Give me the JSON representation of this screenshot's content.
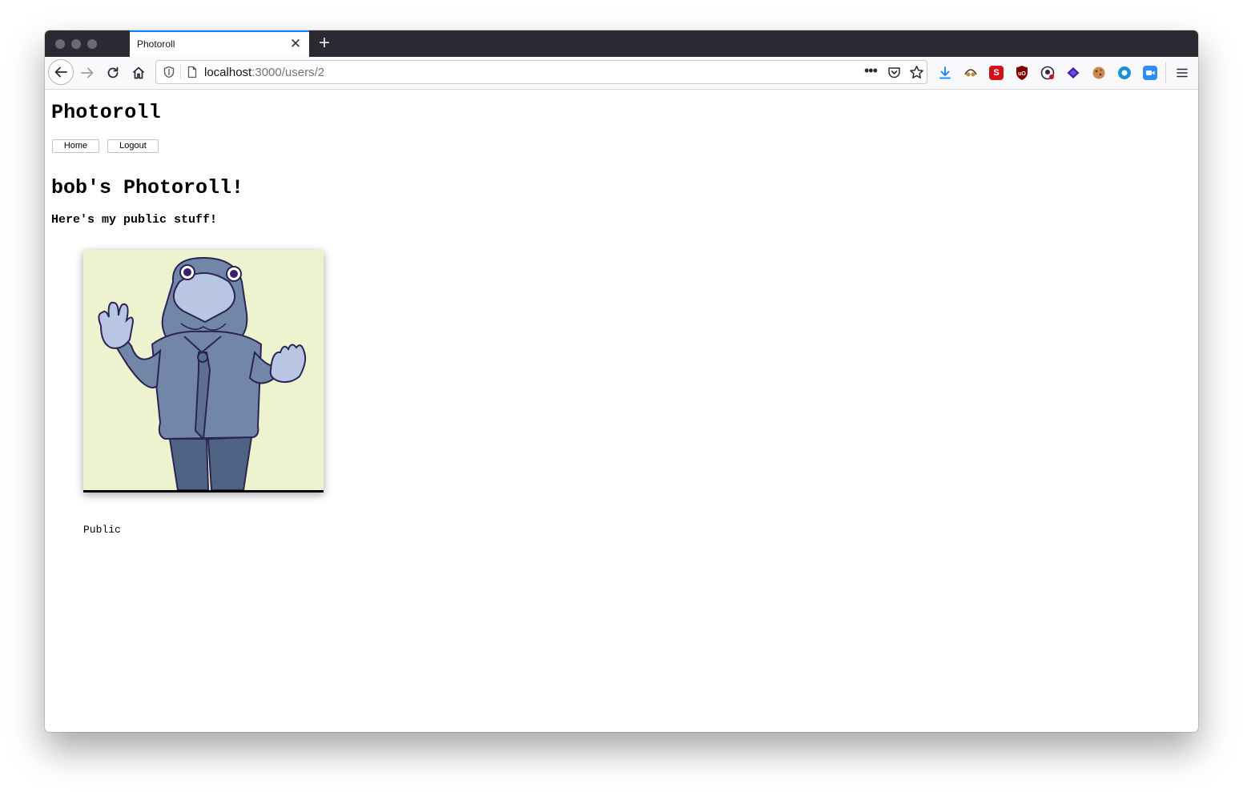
{
  "browser": {
    "tab": {
      "title": "Photoroll"
    },
    "url": {
      "host": "localhost",
      "path": ":3000/users/2"
    }
  },
  "site": {
    "title": "Photoroll",
    "nav": {
      "home_label": "Home",
      "logout_label": "Logout"
    }
  },
  "profile": {
    "heading": "bob's Photoroll!",
    "tagline": "Here's my public stuff!"
  },
  "photos": [
    {
      "visibility": "Public"
    }
  ],
  "colors": {
    "accent": "#0a84ff",
    "photo_background": "#eef3cf",
    "figure": "#7286a8"
  }
}
